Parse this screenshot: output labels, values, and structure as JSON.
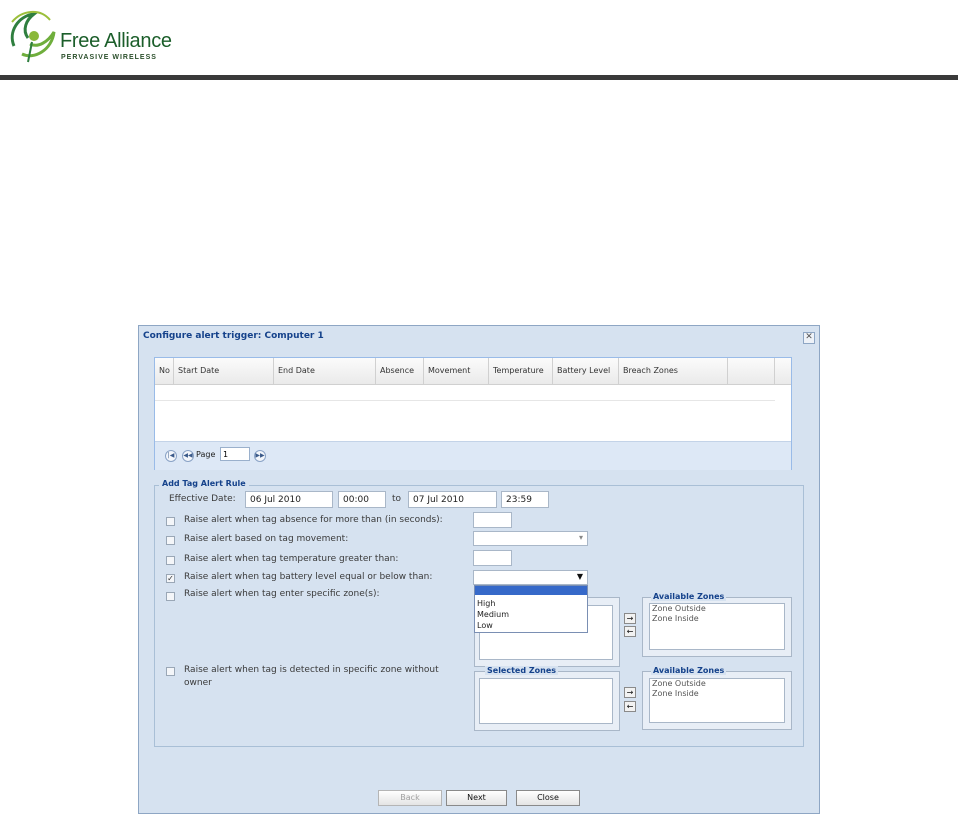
{
  "logo": {
    "brand": "Free Alliance",
    "tagline": "PERVASIVE WIRELESS"
  },
  "dialog": {
    "title": "Configure alert trigger: Computer 1",
    "close_symbol": "✕",
    "grid": {
      "columns": [
        "No",
        "Start Date",
        "End Date",
        "Absence",
        "Movement",
        "Temperature",
        "Battery Level",
        "Breach Zones"
      ],
      "rows": [],
      "pager": {
        "page_label": "Page",
        "page_value": "1"
      }
    },
    "form": {
      "legend": "Add Tag Alert Rule",
      "effective_date_label": "Effective Date:",
      "start_date": "06 Jul 2010",
      "start_time": "00:00",
      "to_label": "to",
      "end_date": "07 Jul 2010",
      "end_time": "23:59",
      "rules": [
        {
          "label": "Raise alert when tag absence for more than (in seconds):",
          "checked": false
        },
        {
          "label": "Raise alert based on tag movement:",
          "checked": false
        },
        {
          "label": "Raise alert when tag temperature greater than:",
          "checked": false
        },
        {
          "label": "Raise alert when tag battery level equal or below than:",
          "checked": true
        },
        {
          "label": "Raise alert when tag enter specific zone(s):",
          "checked": false
        }
      ],
      "owner_rule": {
        "line1": "Raise alert when tag is detected in specific zone without",
        "line2": "owner",
        "checked": false
      },
      "battery_options": [
        "",
        "High",
        "Medium",
        "Low"
      ],
      "zones1": {
        "available_title": "Available Zones",
        "available": [
          "Zone Outside",
          "Zone Inside"
        ]
      },
      "zones2": {
        "selected_title": "Selected Zones",
        "available_title": "Available Zones",
        "available": [
          "Zone Outside",
          "Zone Inside"
        ]
      },
      "move_right": "→",
      "move_left": "←"
    },
    "buttons": {
      "back": "Back",
      "next": "Next",
      "close": "Close"
    }
  }
}
